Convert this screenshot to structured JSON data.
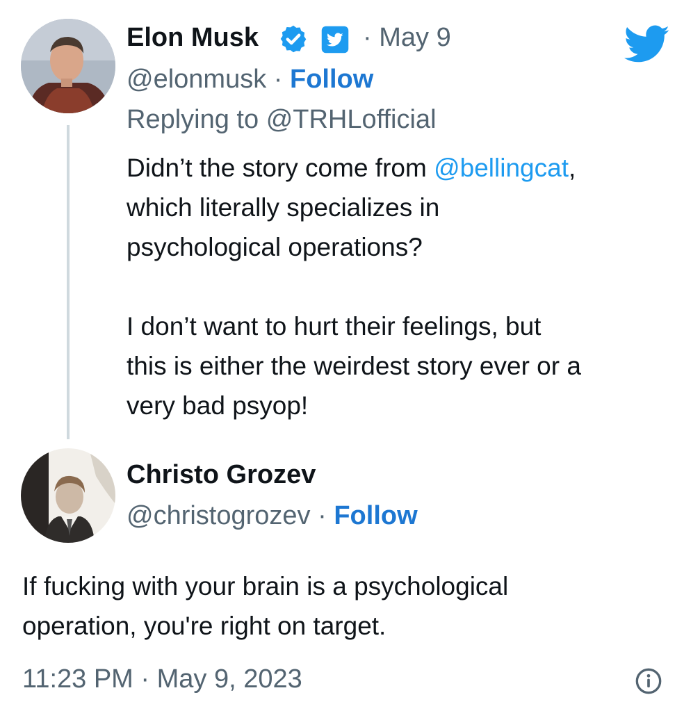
{
  "parent_tweet": {
    "author_name": "Elon Musk",
    "verified_icon": "verified-badge-icon",
    "twitter_badge_icon": "twitter-square-icon",
    "date": "May 9",
    "handle": "@elonmusk",
    "follow_label": "Follow",
    "replying_prefix": "Replying to",
    "replying_to": "@TRHLofficial",
    "text_line1_pre": "Didn’t the story come from",
    "text_line1_mention": "@bellingcat",
    "text_line1_post": ",",
    "text_line2": "which literally specializes in",
    "text_line3": "psychological operations?",
    "text_line4": "I don’t want to hurt their feelings, but",
    "text_line5": "this is either the weirdest story ever or a",
    "text_line6": "very bad psyop!"
  },
  "reply_tweet": {
    "author_name": "Christo Grozev",
    "handle": "@christogrozev",
    "follow_label": "Follow",
    "text_line1": "If fucking with your brain is a psychological",
    "text_line2": "operation, you're right on target.",
    "time": "11:23 PM",
    "date": "May 9, 2023"
  },
  "colors": {
    "twitter_blue": "#1d9bf0",
    "follow_blue": "#1d77d2",
    "secondary_text": "#536471",
    "thread_line": "#cfd9de"
  },
  "icons": {
    "brand": "twitter-bird-icon",
    "info": "info-icon"
  }
}
